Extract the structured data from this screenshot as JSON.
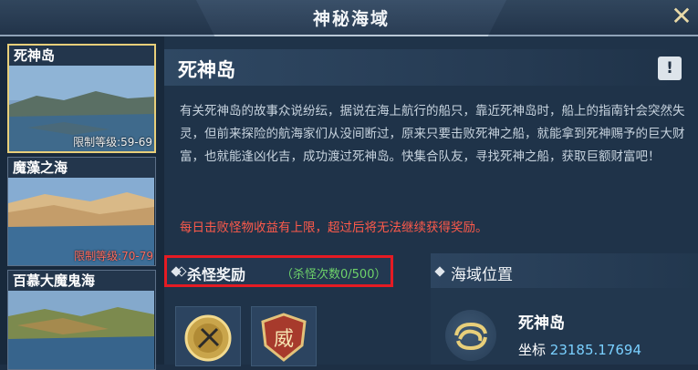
{
  "window": {
    "title": "神秘海域",
    "close_icon": "close-x-icon"
  },
  "sidebar": {
    "items": [
      {
        "name": "死神岛",
        "level": "限制等级:59-69",
        "selected": true
      },
      {
        "name": "魔藻之海",
        "level": "限制等级:70-79",
        "selected": false
      },
      {
        "name": "百慕大魔鬼海",
        "level": "",
        "selected": false
      }
    ]
  },
  "detail": {
    "title": "死神岛",
    "info_button": "!",
    "description": "有关死神岛的故事众说纷纭，据说在海上航行的船只，靠近死神岛时，船上的指南针会突然失灵，但前来探险的航海家们从没间断过，原来只要击败死神之船，就能拿到死神赐予的巨大财富，也就能逢凶化吉，成功渡过死神岛。快集合队友，寻找死神之船，获取巨额财富吧！",
    "warning": "每日击败怪物收益有上限，超过后将无法继续获得奖励。",
    "reward": {
      "label": "杀怪奖励",
      "count": "（杀怪次数0/500）"
    },
    "reward_items": [
      "coin-medal-icon",
      "shield-badge-icon"
    ],
    "location": {
      "label": "海域位置",
      "name": "死神岛",
      "coord_label": "坐标",
      "coord_value": "23185.17694"
    }
  },
  "colors": {
    "accent_gold": "#e8cf7a",
    "warning_red": "#ff5a4a",
    "reward_green": "#6ed36a",
    "highlight_box": "#e51b23"
  }
}
